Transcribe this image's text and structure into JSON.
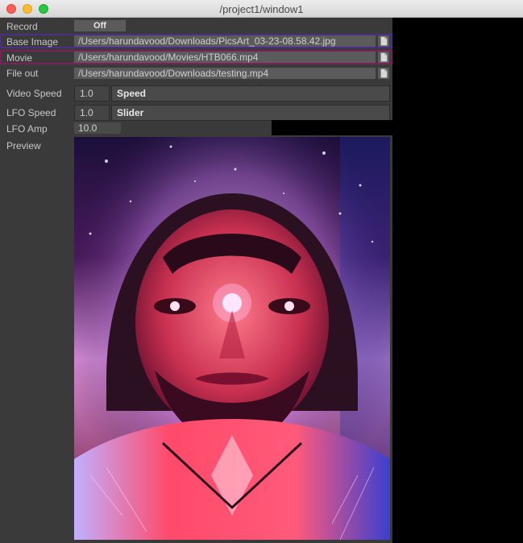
{
  "window": {
    "title": "/project1/window1"
  },
  "rows": {
    "record": {
      "label": "Record",
      "toggle": "Off"
    },
    "base_image": {
      "label": "Base Image",
      "path": "/Users/harundavood/Downloads/PicsArt_03-23-08.58.42.jpg"
    },
    "movie": {
      "label": "Movie",
      "path": "/Users/harundavood/Movies/HTB066.mp4"
    },
    "file_out": {
      "label": "File out",
      "path": "/Users/harundavood/Downloads/testing.mp4"
    },
    "video_speed": {
      "label": "Video Speed",
      "value": "1.0",
      "slider_label": "Speed"
    },
    "lfo_speed": {
      "label": "LFO Speed",
      "value": "1.0",
      "slider_label": "Slider"
    },
    "lfo_amp": {
      "label": "LFO Amp",
      "value": "10.0"
    },
    "preview": {
      "label": "Preview"
    }
  },
  "colors": {
    "panel": "#3a3a3a",
    "field": "#5b5b5b",
    "base_image_highlight": "#4b2f86",
    "movie_highlight": "#7c1f5a"
  }
}
